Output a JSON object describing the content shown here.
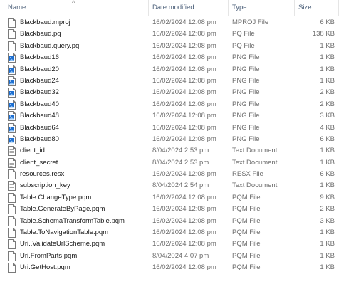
{
  "columns": {
    "name": "Name",
    "date": "Date modified",
    "type": "Type",
    "size": "Size"
  },
  "files": [
    {
      "name": "Blackbaud.mproj",
      "date": "16/02/2024 12:08 pm",
      "type": "MPROJ File",
      "size": "6 KB",
      "icon": "document-icon"
    },
    {
      "name": "Blackbaud.pq",
      "date": "16/02/2024 12:08 pm",
      "type": "PQ File",
      "size": "138 KB",
      "icon": "document-icon"
    },
    {
      "name": "Blackbaud.query.pq",
      "date": "16/02/2024 12:08 pm",
      "type": "PQ File",
      "size": "1 KB",
      "icon": "document-icon"
    },
    {
      "name": "Blackbaud16",
      "date": "16/02/2024 12:08 pm",
      "type": "PNG File",
      "size": "1 KB",
      "icon": "image-file-icon"
    },
    {
      "name": "Blackbaud20",
      "date": "16/02/2024 12:08 pm",
      "type": "PNG File",
      "size": "1 KB",
      "icon": "image-file-icon"
    },
    {
      "name": "Blackbaud24",
      "date": "16/02/2024 12:08 pm",
      "type": "PNG File",
      "size": "1 KB",
      "icon": "image-file-icon"
    },
    {
      "name": "Blackbaud32",
      "date": "16/02/2024 12:08 pm",
      "type": "PNG File",
      "size": "2 KB",
      "icon": "image-file-icon"
    },
    {
      "name": "Blackbaud40",
      "date": "16/02/2024 12:08 pm",
      "type": "PNG File",
      "size": "2 KB",
      "icon": "image-file-icon"
    },
    {
      "name": "Blackbaud48",
      "date": "16/02/2024 12:08 pm",
      "type": "PNG File",
      "size": "3 KB",
      "icon": "image-file-icon"
    },
    {
      "name": "Blackbaud64",
      "date": "16/02/2024 12:08 pm",
      "type": "PNG File",
      "size": "4 KB",
      "icon": "image-file-icon"
    },
    {
      "name": "Blackbaud80",
      "date": "16/02/2024 12:08 pm",
      "type": "PNG File",
      "size": "6 KB",
      "icon": "image-file-icon"
    },
    {
      "name": "client_id",
      "date": "8/04/2024 2:53 pm",
      "type": "Text Document",
      "size": "1 KB",
      "icon": "text-file-icon"
    },
    {
      "name": "client_secret",
      "date": "8/04/2024 2:53 pm",
      "type": "Text Document",
      "size": "1 KB",
      "icon": "text-file-icon"
    },
    {
      "name": "resources.resx",
      "date": "16/02/2024 12:08 pm",
      "type": "RESX File",
      "size": "6 KB",
      "icon": "document-icon"
    },
    {
      "name": "subscription_key",
      "date": "8/04/2024 2:54 pm",
      "type": "Text Document",
      "size": "1 KB",
      "icon": "text-file-icon"
    },
    {
      "name": "Table.ChangeType.pqm",
      "date": "16/02/2024 12:08 pm",
      "type": "PQM File",
      "size": "9 KB",
      "icon": "document-icon"
    },
    {
      "name": "Table.GenerateByPage.pqm",
      "date": "16/02/2024 12:08 pm",
      "type": "PQM File",
      "size": "2 KB",
      "icon": "document-icon"
    },
    {
      "name": "Table.SchemaTransformTable.pqm",
      "date": "16/02/2024 12:08 pm",
      "type": "PQM File",
      "size": "3 KB",
      "icon": "document-icon"
    },
    {
      "name": "Table.ToNavigationTable.pqm",
      "date": "16/02/2024 12:08 pm",
      "type": "PQM File",
      "size": "1 KB",
      "icon": "document-icon"
    },
    {
      "name": "Uri..ValidateUrlScheme.pqm",
      "date": "16/02/2024 12:08 pm",
      "type": "PQM File",
      "size": "1 KB",
      "icon": "document-icon"
    },
    {
      "name": "Uri.FromParts.pqm",
      "date": "8/04/2024 4:07 pm",
      "type": "PQM File",
      "size": "1 KB",
      "icon": "document-icon"
    },
    {
      "name": "Uri.GetHost.pqm",
      "date": "16/02/2024 12:08 pm",
      "type": "PQM File",
      "size": "1 KB",
      "icon": "document-icon"
    }
  ],
  "colors": {
    "header_text": "#4c607a",
    "meta_text": "#6d6d6d",
    "png_icon_blue": "#1e6fd0"
  }
}
